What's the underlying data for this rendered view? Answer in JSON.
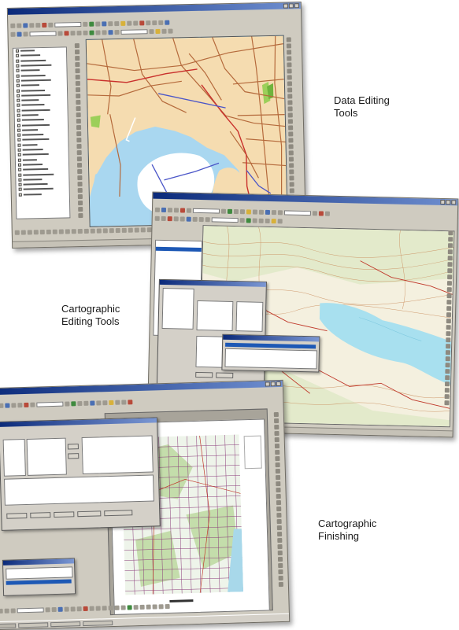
{
  "captions": {
    "data_editing": {
      "line1": "Data Editing",
      "line2": "Tools"
    },
    "cartographic_editing": {
      "line1": "Cartographic",
      "line2": "Editing Tools"
    },
    "cartographic_finishing": {
      "line1": "Cartographic",
      "line2": "Finishing"
    }
  },
  "colors": {
    "water": "#a9d7f0",
    "land": "#f5dcb0",
    "road": "#b56a3c",
    "park": "#9ccf5a",
    "route": "#4a55c8",
    "title_bar": "#0b2a7a",
    "window_face": "#cfcbc0"
  },
  "windows": [
    {
      "name": "data-editing-window",
      "icons": [
        "layer-list-icon",
        "map-view-icon",
        "editor-toolbar-icon"
      ]
    },
    {
      "name": "cartographic-editing-window",
      "icons": [
        "topographic-map-icon",
        "dialog-icon",
        "list-selection-icon"
      ]
    },
    {
      "name": "cartographic-finishing-window",
      "icons": [
        "layout-page-icon",
        "map-grid-icon",
        "task-bar-icon"
      ]
    }
  ]
}
